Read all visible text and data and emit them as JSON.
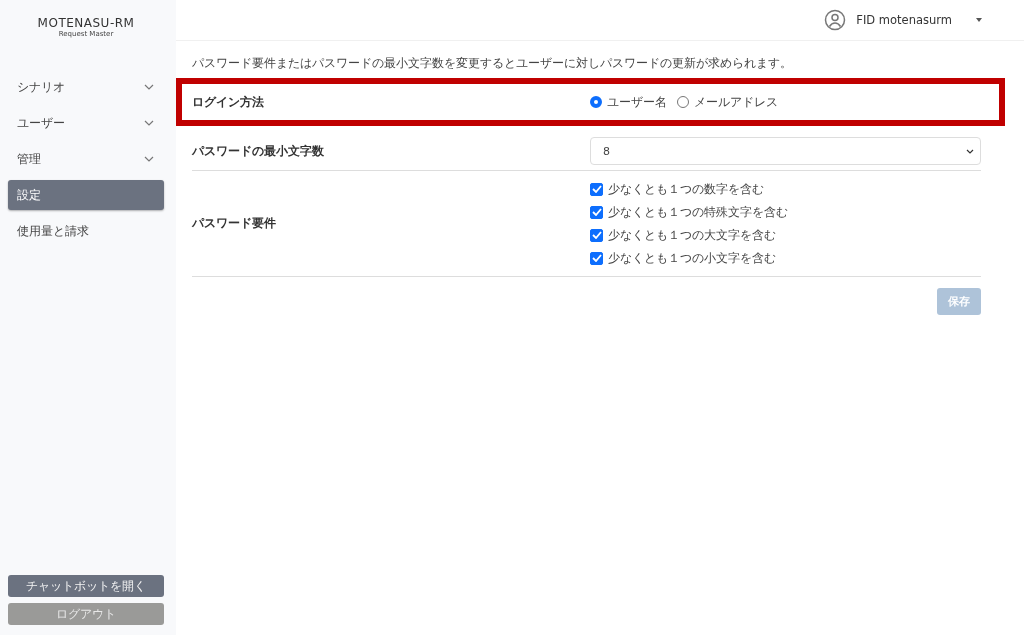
{
  "logo": {
    "title": "MOTENASU-RM",
    "subtitle": "Request Master"
  },
  "sidebar": {
    "items": [
      {
        "label": "シナリオ",
        "kind": "group",
        "selected": false
      },
      {
        "label": "ユーザー",
        "kind": "group",
        "selected": false
      },
      {
        "label": "管理",
        "kind": "group",
        "selected": false
      },
      {
        "label": "設定",
        "kind": "link",
        "selected": true
      },
      {
        "label": "使用量と請求",
        "kind": "link",
        "selected": false
      }
    ],
    "buttons": [
      {
        "label": "チャットボットを開く",
        "kind": "primary"
      },
      {
        "label": "ログアウト",
        "kind": "secondary"
      }
    ]
  },
  "header": {
    "user": "FID motenasurm"
  },
  "notice": "パスワード要件またはパスワードの最小文字数を変更するとユーザーに対しパスワードの更新が求められます。",
  "settings": [
    {
      "label": "ログイン方法",
      "kind": "radio",
      "highlighted": true,
      "options": [
        {
          "label": "ユーザー名",
          "selected": true
        },
        {
          "label": "メールアドレス",
          "selected": false
        }
      ]
    },
    {
      "label": "パスワードの最小文字数",
      "kind": "select",
      "highlighted": false,
      "value": "8"
    },
    {
      "label": "パスワード要件",
      "kind": "checkboxes",
      "highlighted": false,
      "options": [
        {
          "label": "少なくとも１つの数字を含む",
          "checked": true
        },
        {
          "label": "少なくとも１つの特殊文字を含む",
          "checked": true
        },
        {
          "label": "少なくとも１つの大文字を含む",
          "checked": true
        },
        {
          "label": "少なくとも１つの小文字を含む",
          "checked": true
        }
      ]
    }
  ],
  "save_button": {
    "label": "保存",
    "disabled": true
  }
}
